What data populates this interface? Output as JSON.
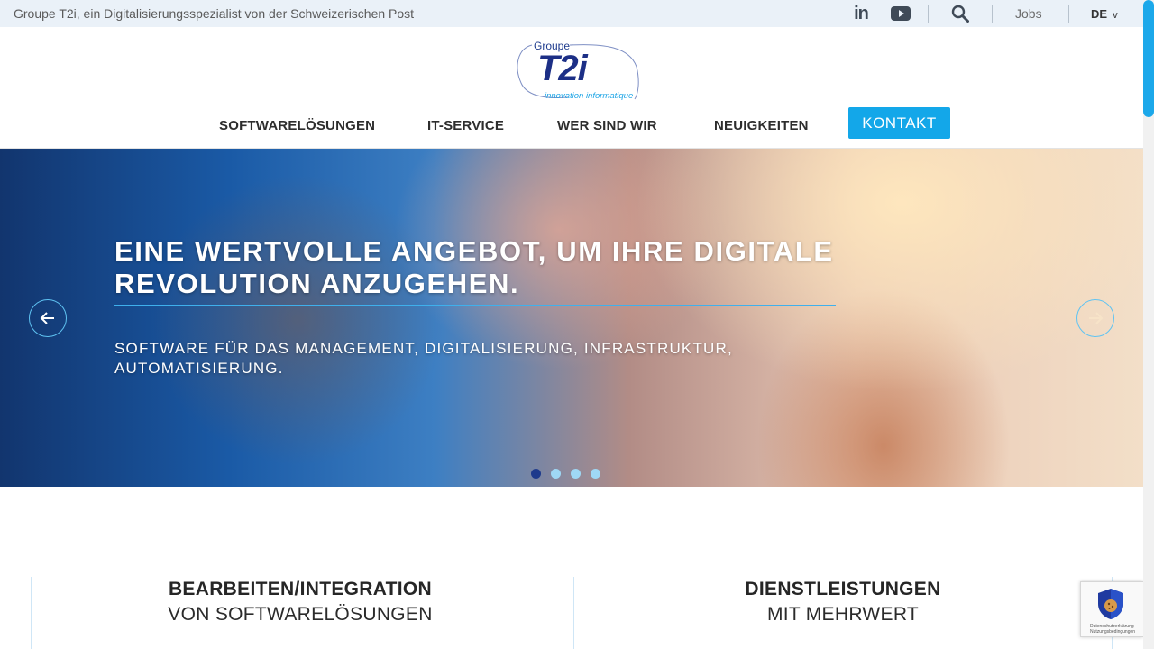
{
  "topbar": {
    "tagline": "Groupe T2i, ein Digitalisierungsspezialist von der Schweizerischen Post",
    "linkedin": "in",
    "jobs": "Jobs",
    "language": "DE",
    "language_chevron": "v"
  },
  "logo": {
    "groupe": "Groupe",
    "name": "T2i",
    "subtitle": "innovation informatique"
  },
  "nav": {
    "items": [
      "SOFTWARELÖSUNGEN",
      "IT-SERVICE",
      "WER SIND WIR",
      "NEUIGKEITEN"
    ],
    "cta": "KONTAKT"
  },
  "hero": {
    "headline": "EINE WERTVOLLE ANGEBOT, UM IHRE DIGITALE REVOLUTION ANZUGEHEN.",
    "subline": "SOFTWARE FÜR DAS MANAGEMENT, DIGITALISIERUNG, INFRASTRUKTUR, AUTOMATISIERUNG.",
    "prev_icon": "arrow-left-icon",
    "next_icon": "arrow-right-icon",
    "slide_count": 4,
    "active_slide": 1
  },
  "services": [
    {
      "title": "BEARBEITEN/INTEGRATION",
      "subtitle": "VON SOFTWARELÖSUNGEN"
    },
    {
      "title": "DIENSTLEISTUNGEN",
      "subtitle": "MIT MEHRWERT"
    }
  ],
  "recaptcha": {
    "text": "Datenschutzerklärung - Nutzungsbedingungen"
  },
  "colors": {
    "accent": "#13a7e9",
    "brand_navy": "#1c2f86",
    "topbar_bg": "#eaf1f8"
  }
}
